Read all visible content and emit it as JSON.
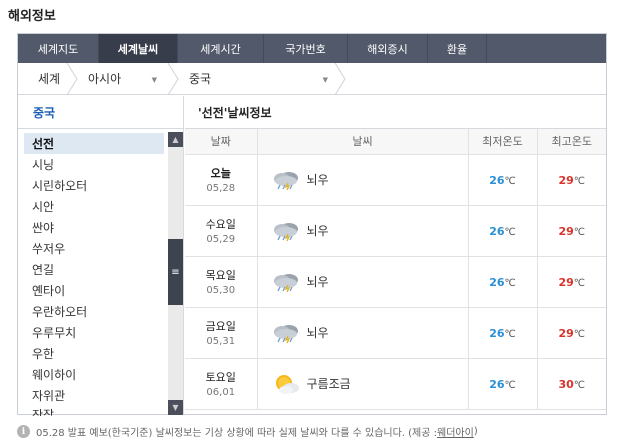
{
  "page": {
    "title": "해외정보"
  },
  "tabs": [
    {
      "label": "세계지도",
      "active": false
    },
    {
      "label": "세계날씨",
      "active": true
    },
    {
      "label": "세계시간",
      "active": false
    },
    {
      "label": "국가번호",
      "active": false
    },
    {
      "label": "해외증시",
      "active": false
    },
    {
      "label": "환율",
      "active": false
    }
  ],
  "breadcrumb": {
    "world": "세계",
    "region": "아시아",
    "country": "중국"
  },
  "left": {
    "heading": "중국",
    "cities": [
      "선전",
      "시닝",
      "시린하오터",
      "시안",
      "싼야",
      "쑤저우",
      "연길",
      "옌타이",
      "우란하오터",
      "우루무치",
      "우한",
      "웨이하이",
      "자위관",
      "잔장"
    ],
    "selected_index": 0
  },
  "right": {
    "heading": "'선전'날씨정보",
    "columns": [
      "날짜",
      "날씨",
      "최저온도",
      "최고온도"
    ],
    "unit": "℃",
    "rows": [
      {
        "day": "오늘",
        "date": "05,28",
        "icon": "cloud-rain-thunder-icon",
        "weather": "뇌우",
        "low": "26",
        "high": "29"
      },
      {
        "day": "수요일",
        "date": "05,29",
        "icon": "cloud-rain-thunder-icon",
        "weather": "뇌우",
        "low": "26",
        "high": "29"
      },
      {
        "day": "목요일",
        "date": "05,30",
        "icon": "cloud-rain-thunder-icon",
        "weather": "뇌우",
        "low": "26",
        "high": "29"
      },
      {
        "day": "금요일",
        "date": "05,31",
        "icon": "cloud-rain-thunder-icon",
        "weather": "뇌우",
        "low": "26",
        "high": "29"
      },
      {
        "day": "토요일",
        "date": "06,01",
        "icon": "sun-cloud-icon",
        "weather": "구름조금",
        "low": "26",
        "high": "30"
      }
    ]
  },
  "footnote": {
    "text": "05.28 발표 예보(한국기준) 날씨정보는 기상 상황에 따라 실제 날씨와 다를 수 있습니다. (제공 : ",
    "provider": "웨더아이",
    "close": ")"
  },
  "colors": {
    "tab_bg": "#52596a",
    "tab_active": "#373d4a",
    "low_temp": "#2a8fd6",
    "high_temp": "#d8342b",
    "selected_bg": "#dde8f3"
  }
}
